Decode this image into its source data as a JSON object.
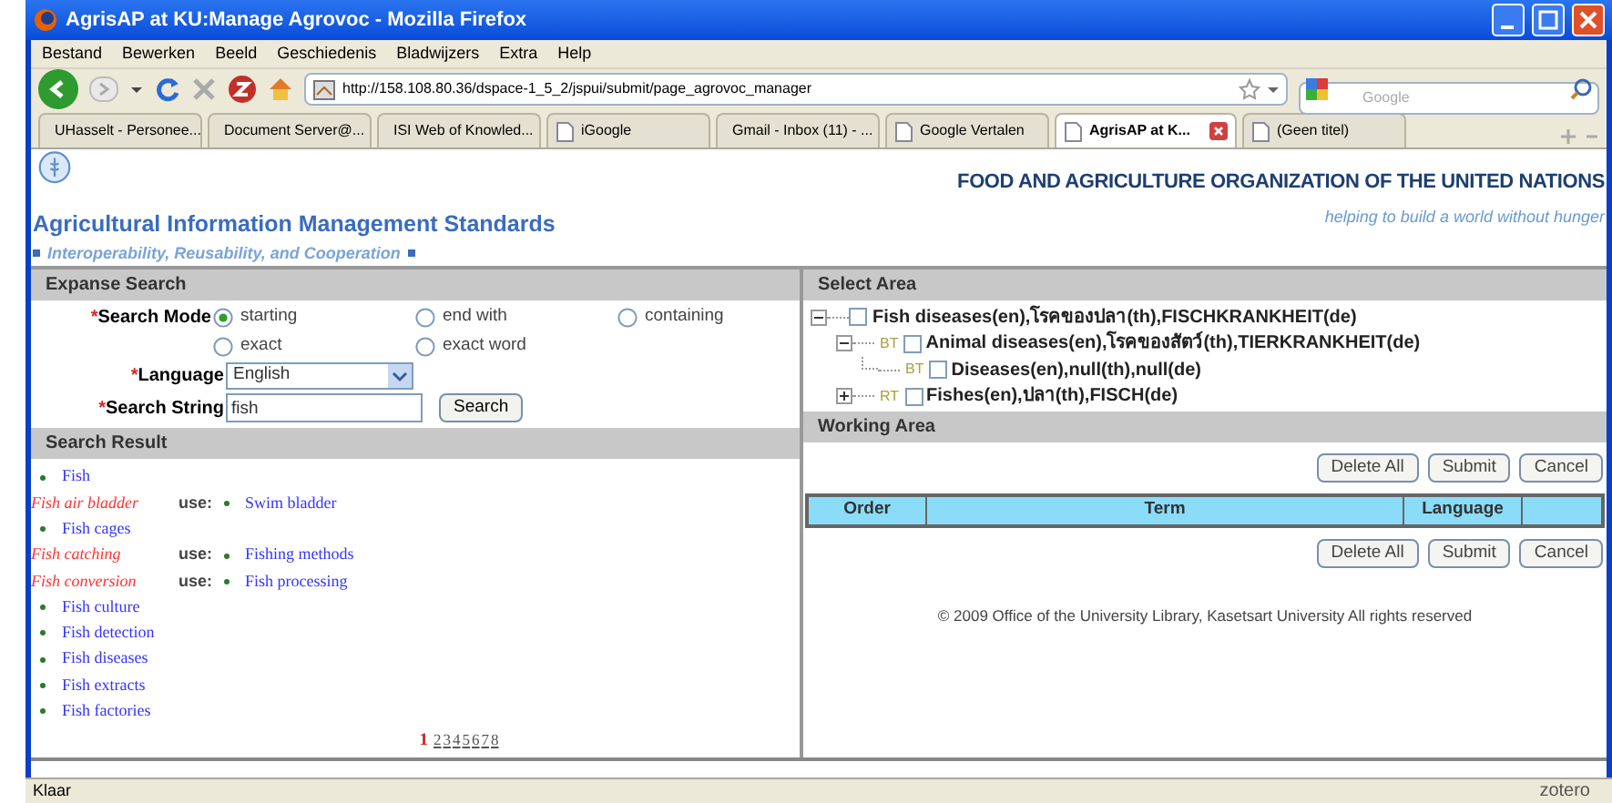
{
  "window": {
    "title": "AgrisAP at KU:Manage Agrovoc - Mozilla Firefox"
  },
  "menu": [
    "Bestand",
    "Bewerken",
    "Beeld",
    "Geschiedenis",
    "Bladwijzers",
    "Extra",
    "Help"
  ],
  "address_bar": {
    "value": "http://158.108.80.36/dspace-1_5_2/jspui/submit/page_agrovoc_manager"
  },
  "search_box": {
    "placeholder": "Google"
  },
  "tabs": [
    {
      "label": "UHasselt - Personee...",
      "selected": false
    },
    {
      "label": "Document Server@...",
      "selected": false
    },
    {
      "label": "ISI Web of Knowled...",
      "selected": false
    },
    {
      "label": "iGoogle",
      "selected": false
    },
    {
      "label": "Gmail - Inbox (11) - ...",
      "selected": false
    },
    {
      "label": "Google Vertalen",
      "selected": false
    },
    {
      "label": "AgrisAP at K...",
      "selected": true
    },
    {
      "label": "(Geen titel)",
      "selected": false
    }
  ],
  "site": {
    "org": "FOOD AND AGRICULTURE ORGANIZATION OF THE UNITED NATIONS",
    "slogan": "helping to build a world without hunger",
    "title": "Agricultural Information Management Standards",
    "subtitle": "Interoperability, Reusability, and Cooperation"
  },
  "expanse_search": {
    "heading": "Expanse Search",
    "required_mark": "*",
    "mode_label": "Search Mode",
    "modes": [
      {
        "label": "starting",
        "selected": true
      },
      {
        "label": "end with",
        "selected": false
      },
      {
        "label": "containing",
        "selected": false
      },
      {
        "label": "exact",
        "selected": false
      },
      {
        "label": "exact word",
        "selected": false
      }
    ],
    "language_label": "Language",
    "language": "English",
    "string_label": "Search String",
    "string": "fish",
    "button": "Search"
  },
  "search_result": {
    "heading": "Search Result",
    "items": [
      {
        "kind": "term",
        "term": "Fish"
      },
      {
        "kind": "use",
        "term": "Fish air bladder",
        "use_label": "use:",
        "target": "Swim bladder"
      },
      {
        "kind": "term",
        "term": "Fish cages"
      },
      {
        "kind": "use",
        "term": "Fish catching",
        "use_label": "use:",
        "target": "Fishing methods"
      },
      {
        "kind": "use",
        "term": "Fish conversion",
        "use_label": "use:",
        "target": "Fish processing"
      },
      {
        "kind": "term",
        "term": "Fish culture"
      },
      {
        "kind": "term",
        "term": "Fish detection"
      },
      {
        "kind": "term",
        "term": "Fish diseases"
      },
      {
        "kind": "term",
        "term": "Fish extracts"
      },
      {
        "kind": "term",
        "term": "Fish factories"
      }
    ],
    "pages": [
      {
        "label": "1",
        "selected": true
      },
      {
        "label": "2",
        "selected": false
      },
      {
        "label": "3",
        "selected": false
      },
      {
        "label": "4",
        "selected": false
      },
      {
        "label": "5",
        "selected": false
      },
      {
        "label": "6",
        "selected": false
      },
      {
        "label": "7",
        "selected": false
      },
      {
        "label": "8",
        "selected": false
      }
    ]
  },
  "select_area": {
    "heading": "Select Area",
    "tree": [
      {
        "label": "Fish diseases(en),โรคของปลา(th),FISCHKRANKHEIT(de)",
        "checked": false,
        "expanded": true,
        "children": [
          {
            "relation": "BT",
            "label": "Animal diseases(en),โรคของสัตว์(th),TIERKRANKHEIT(de)",
            "checked": false,
            "expanded": true,
            "children": [
              {
                "relation": "BT",
                "label": "Diseases(en),null(th),null(de)",
                "checked": false
              }
            ]
          },
          {
            "relation": "RT",
            "label": "Fishes(en),ปลา(th),FISCH(de)",
            "checked": false,
            "expanded": false
          }
        ]
      }
    ]
  },
  "working_area": {
    "heading": "Working Area",
    "buttons_top": [
      "Delete All",
      "Submit",
      "Cancel"
    ],
    "columns": [
      "Order",
      "Term",
      "Language"
    ],
    "buttons_bottom": [
      "Delete All",
      "Submit",
      "Cancel"
    ]
  },
  "footer": "© 2009 Office of the University Library, Kasetsart University All rights reserved",
  "status_bar": {
    "text": "Klaar",
    "addon": "zotero"
  }
}
